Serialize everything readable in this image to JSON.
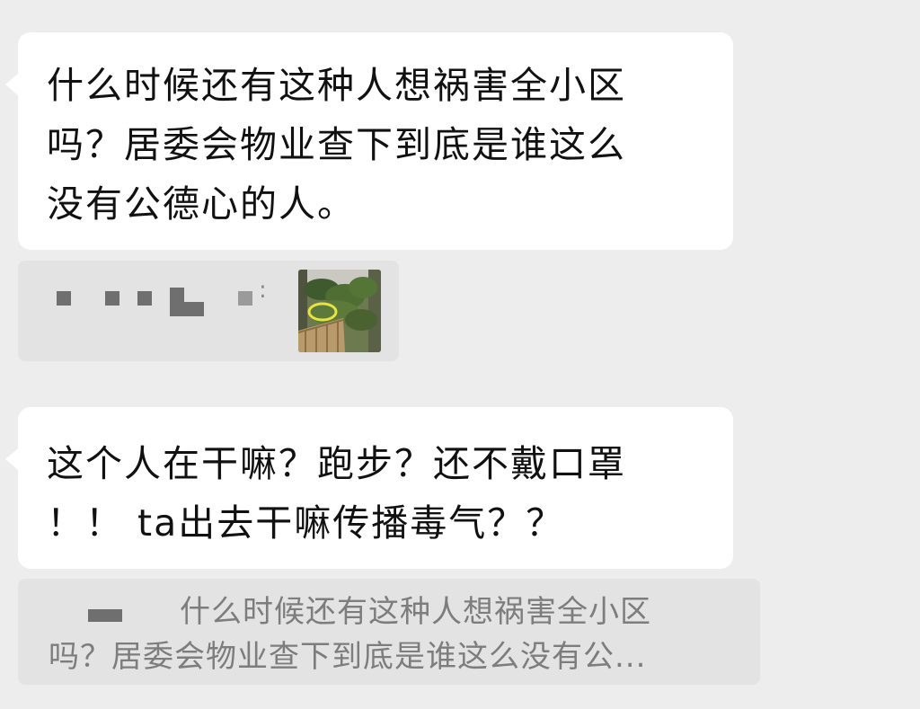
{
  "messages": [
    {
      "lines": [
        "什么时候还有这种人想祸害全小区",
        "吗？居委会物业查下到底是谁这么",
        "没有公德心的人。"
      ],
      "quote": {
        "author": "",
        "image": "outdoor-photo"
      }
    },
    {
      "lines": [
        "这个人在干嘛？跑步？还不戴口罩",
        "！！ ta出去干嘛传播毒气？？"
      ],
      "quote": {
        "author": "",
        "text_lines": [
          "什么时候还有这种人想祸害全小区",
          "吗？居委会物业查下到底是谁这么没有公..."
        ]
      }
    }
  ],
  "colors": {
    "background": "#ededed",
    "bubble": "#ffffff",
    "quote_background": "#e3e3e3",
    "quote_text": "#7d7d7d",
    "redaction": "#6f6f6f"
  }
}
